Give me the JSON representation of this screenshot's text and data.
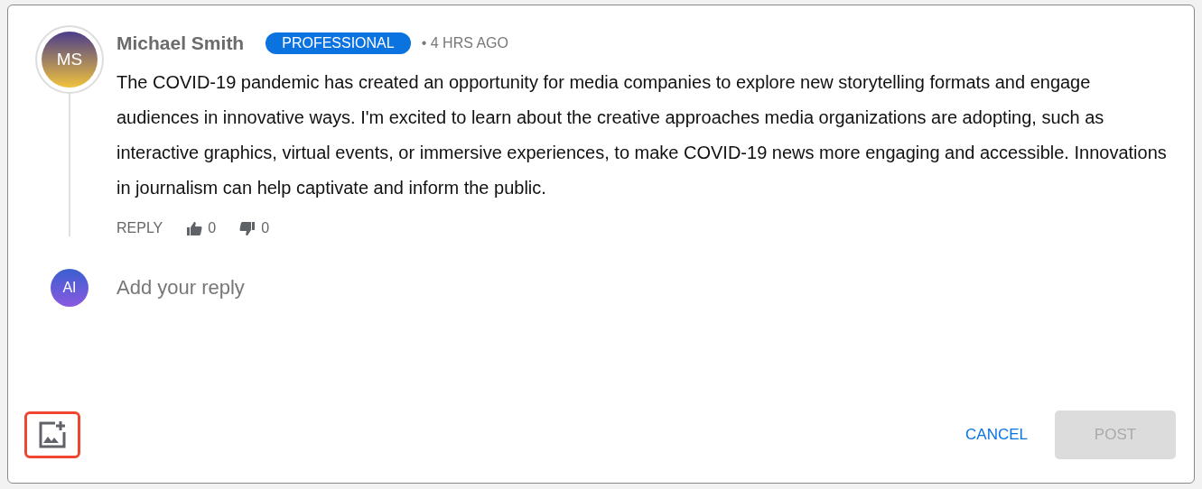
{
  "comment": {
    "avatar_initials": "MS",
    "author": "Michael Smith",
    "badge": "PROFESSIONAL",
    "time": "• 4 HRS AGO",
    "body": "The COVID-19 pandemic has created an opportunity for media companies to explore new storytelling formats and engage audiences in innovative ways. I'm excited to learn about the creative approaches media organizations are adopting, such as interactive graphics, virtual events, or immersive experiences, to make COVID-19 news more engaging and accessible. Innovations in journalism can help captivate and inform the public.",
    "reply_label": "REPLY",
    "likes": "0",
    "dislikes": "0"
  },
  "reply_box": {
    "avatar_initials": "AI",
    "placeholder": "Add your reply"
  },
  "footer": {
    "image_button": {
      "highlighted": true
    },
    "cancel": "CANCEL",
    "post": {
      "label": "POST",
      "disabled": true
    }
  }
}
